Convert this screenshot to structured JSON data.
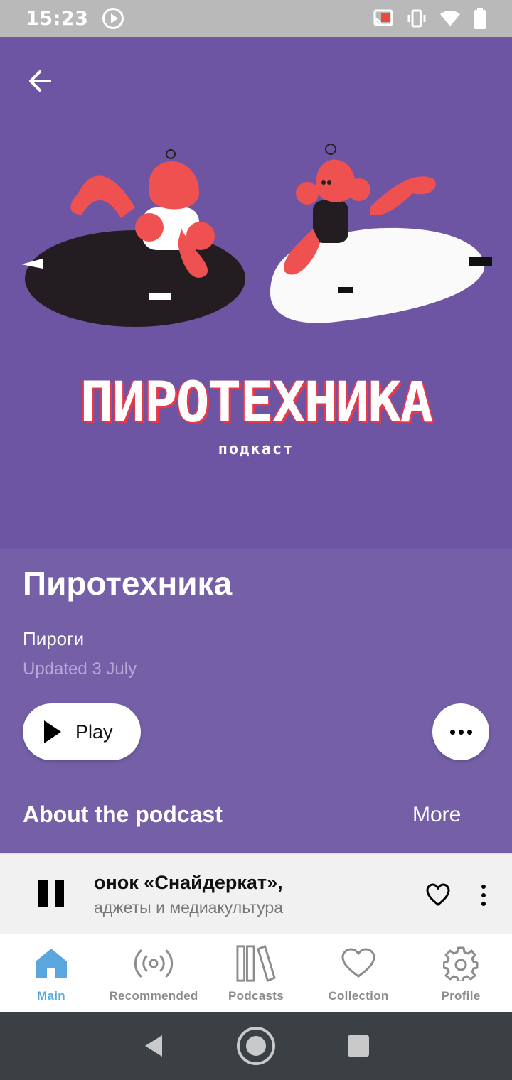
{
  "status_bar": {
    "time": "15:23"
  },
  "cover": {
    "title_art": "ПИРОТЕХНИКА",
    "subtitle_art": "подкаст"
  },
  "podcast": {
    "title": "Пиротехника",
    "author": "Пироги",
    "updated": "Updated 3 July",
    "play_label": "Play",
    "about_heading": "About the podcast",
    "about_more": "More"
  },
  "mini_player": {
    "title": "онок               «Снайдеркат»,",
    "subtitle": "аджеты и медиакультура"
  },
  "bottom_nav": {
    "items": [
      {
        "label": "Main",
        "icon": "home-icon",
        "active": true
      },
      {
        "label": "Recommended",
        "icon": "broadcast-icon",
        "active": false
      },
      {
        "label": "Podcasts",
        "icon": "books-icon",
        "active": false
      },
      {
        "label": "Collection",
        "icon": "heart-icon",
        "active": false
      },
      {
        "label": "Profile",
        "icon": "gear-icon",
        "active": false
      }
    ]
  },
  "colors": {
    "background": "#7560a8",
    "accent": "#5aa7e0",
    "art_red": "#e8394a"
  }
}
